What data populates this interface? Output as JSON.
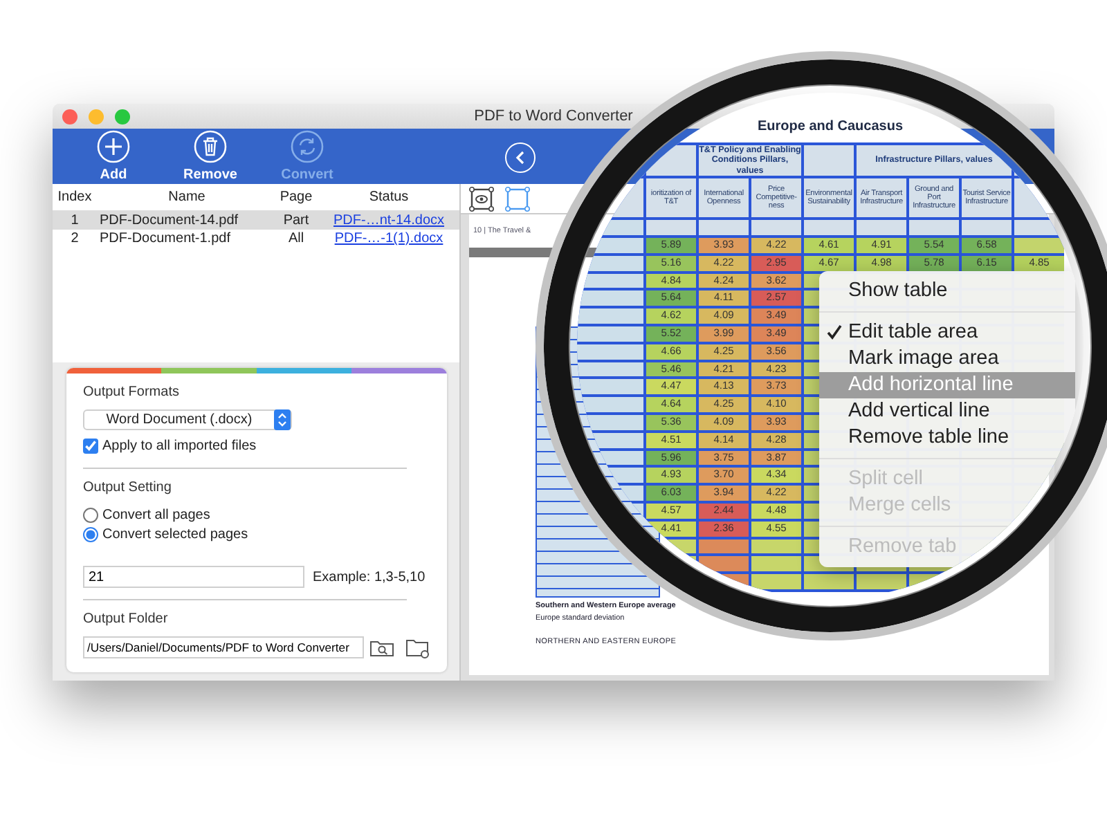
{
  "window": {
    "title": "PDF to Word Converter"
  },
  "toolbar": [
    {
      "label": "Add",
      "kind": "add",
      "disabled": false
    },
    {
      "label": "Remove",
      "kind": "remove",
      "disabled": false
    },
    {
      "label": "Convert",
      "kind": "convert",
      "disabled": true
    }
  ],
  "file_table": {
    "columns": [
      "Index",
      "Name",
      "Page",
      "Status"
    ],
    "rows": [
      {
        "index": "1",
        "name": "PDF-Document-14.pdf",
        "page": "Part",
        "status": "PDF-…nt-14.docx",
        "selected": true
      },
      {
        "index": "2",
        "name": "PDF-Document-1.pdf",
        "page": "All",
        "status": "PDF-…-1(1).docx",
        "selected": false
      }
    ]
  },
  "output_formats": {
    "title": "Output Formats",
    "format": "Word Document (.docx)",
    "apply_all": {
      "label": "Apply to all imported files",
      "checked": true
    }
  },
  "output_setting": {
    "title": "Output Setting",
    "options": [
      {
        "label": "Convert all pages",
        "selected": false
      },
      {
        "label": "Convert selected pages",
        "selected": true
      }
    ],
    "pages": "21",
    "example": "Example: 1,3-5,10"
  },
  "output_folder": {
    "title": "Output Folder",
    "path": "/Users/Daniel/Documents/PDF to Word Converter"
  },
  "preview": {
    "tools": [
      {
        "kind": "eye",
        "selected": false
      },
      {
        "kind": "frame",
        "selected": true
      }
    ],
    "page_header": "10 | The Travel &",
    "footer_lines": [
      {
        "text": "Southern and Western Europe average",
        "kind": "bold"
      },
      {
        "text": "Europe standard deviation",
        "kind": "plain"
      },
      {
        "text": "NORTHERN AND EASTERN EUROPE",
        "kind": "heading"
      }
    ]
  },
  "magnifier": {
    "title": "Europe and Caucasus",
    "groups": [
      "T&T Policy and Enabling Conditions Pillars, values",
      "Infrastructure Pillars, values"
    ],
    "columns": [
      "ioritization of T&T",
      "International Openness",
      "Price Competitive-ness",
      "Environmental Sustainability",
      "Air Transport Infrastructure",
      "Ground and Port Infrastructure",
      "Tourist Service Infrastructure"
    ],
    "rows": [
      {
        "cells": [
          "5.89",
          "3.93",
          "4.22",
          "4.61",
          "4.91",
          "5.54",
          "6.58"
        ]
      },
      {
        "cells": [
          "5.16",
          "4.22",
          "2.95",
          "4.67",
          "4.98",
          "5.78",
          "6.15",
          "4.85"
        ]
      },
      {
        "cells": [
          "4.84",
          "4.24",
          "3.62"
        ]
      },
      {
        "cells": [
          "5.64",
          "4.11",
          "2.57"
        ]
      },
      {
        "cells": [
          "4.62",
          "4.09",
          "3.49"
        ]
      },
      {
        "cells": [
          "5.52",
          "3.99",
          "3.49"
        ]
      },
      {
        "cells": [
          "4.66",
          "4.25",
          "3.56"
        ]
      },
      {
        "cells": [
          "5.46",
          "4.21",
          "4.23"
        ]
      },
      {
        "cells": [
          "4.47",
          "4.13",
          "3.73"
        ]
      },
      {
        "cells": [
          "4.64",
          "4.25",
          "4.10"
        ]
      },
      {
        "cells": [
          "5.36",
          "4.09",
          "3.93"
        ]
      },
      {
        "cells": [
          "4.51",
          "4.14",
          "4.28"
        ]
      },
      {
        "cells": [
          "5.96",
          "3.75",
          "3.87"
        ]
      },
      {
        "cells": [
          "4.93",
          "3.70",
          "4.34"
        ]
      },
      {
        "cells": [
          "6.03",
          "3.94",
          "4.22"
        ]
      },
      {
        "cells": [
          "4.57",
          "2.44",
          "4.48"
        ]
      },
      {
        "cells": [
          "4.41",
          "2.36",
          "4.55"
        ]
      }
    ],
    "menu": [
      {
        "kind": "item",
        "label": "Show table",
        "checked": false,
        "selected": false,
        "disabled": false
      },
      {
        "kind": "separator"
      },
      {
        "kind": "item",
        "label": "Edit table area",
        "checked": true,
        "selected": false,
        "disabled": false
      },
      {
        "kind": "item",
        "label": "Mark image area",
        "checked": false,
        "selected": false,
        "disabled": false
      },
      {
        "kind": "item",
        "label": "Add horizontal line",
        "checked": false,
        "selected": true,
        "disabled": false
      },
      {
        "kind": "item",
        "label": "Add vertical line",
        "checked": false,
        "selected": false,
        "disabled": false
      },
      {
        "kind": "item",
        "label": "Remove table line",
        "checked": false,
        "selected": false,
        "disabled": false
      },
      {
        "kind": "separator"
      },
      {
        "kind": "item",
        "label": "Split cell",
        "checked": false,
        "selected": false,
        "disabled": true
      },
      {
        "kind": "item",
        "label": "Merge cells",
        "checked": false,
        "selected": false,
        "disabled": true
      },
      {
        "kind": "separator"
      },
      {
        "kind": "item",
        "label": "Remove tab",
        "checked": false,
        "selected": false,
        "disabled": true
      }
    ]
  }
}
